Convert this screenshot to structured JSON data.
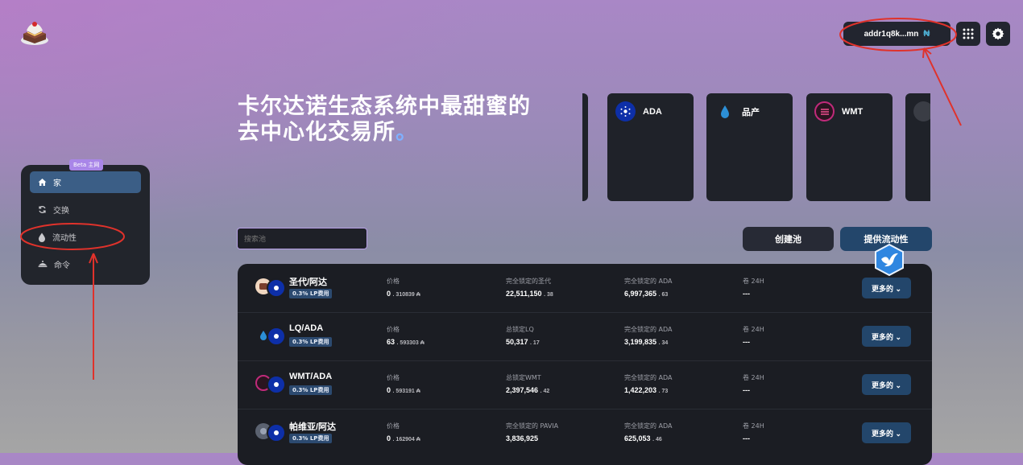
{
  "header": {
    "wallet_address": "addr1q8k...mn",
    "wallet_network_glyph": "₦"
  },
  "hero": {
    "line1": "卡尔达诺生态系统中最甜蜜的",
    "line2": "去中心化交易所",
    "dot": "。"
  },
  "tokens": [
    {
      "symbol": "ADA",
      "icon": "cardano-icon",
      "color": "#0d2fa8"
    },
    {
      "symbol": "品产",
      "icon": "water-drop-icon",
      "color": "#2c8fd6"
    },
    {
      "symbol": "WMT",
      "icon": "wmt-icon",
      "color": "#c02a7a"
    }
  ],
  "sidebar": {
    "badge": "Beta 主网",
    "items": [
      {
        "label": "家",
        "icon": "home-icon",
        "active": true
      },
      {
        "label": "交换",
        "icon": "swap-icon",
        "active": false
      },
      {
        "label": "流动性",
        "icon": "drop-icon",
        "active": false
      },
      {
        "label": "命令",
        "icon": "orders-icon",
        "active": false
      }
    ]
  },
  "search": {
    "placeholder": "搜索池"
  },
  "actions": {
    "create_pool": "创建池",
    "provide_liquidity": "提供流动性"
  },
  "pools": [
    {
      "pair": "圣代/阿达",
      "fee": "0.3% LP费用",
      "price_label": "价格",
      "price_main": "0",
      "price_small": ". 310839 ₳",
      "locked1_label": "完全锁定的圣代",
      "locked1_main": "22,511,150",
      "locked1_small": ". 38",
      "locked2_label": "完全锁定的 ADA",
      "locked2_main": "6,997,365",
      "locked2_small": ". 63",
      "vol_label": "卷 24H",
      "vol_value": "---",
      "more": "更多的 ⌄"
    },
    {
      "pair": "LQ/ADA",
      "fee": "0.3% LP费用",
      "price_label": "价格",
      "price_main": "63",
      "price_small": ". 593303 ₳",
      "locked1_label": "总锁定LQ",
      "locked1_main": "50,317",
      "locked1_small": ". 17",
      "locked2_label": "完全锁定的 ADA",
      "locked2_main": "3,199,835",
      "locked2_small": ". 34",
      "vol_label": "卷 24H",
      "vol_value": "---",
      "more": "更多的 ⌄"
    },
    {
      "pair": "WMT/ADA",
      "fee": "0.3% LP费用",
      "price_label": "价格",
      "price_main": "0",
      "price_small": ". 593191 ₳",
      "locked1_label": "总锁定WMT",
      "locked1_main": "2,397,546",
      "locked1_small": ". 42",
      "locked2_label": "完全锁定的 ADA",
      "locked2_main": "1,422,203",
      "locked2_small": ". 73",
      "vol_label": "卷 24H",
      "vol_value": "---",
      "more": "更多的 ⌄"
    },
    {
      "pair": "帕维亚/阿达",
      "fee": "0.3% LP费用",
      "price_label": "价格",
      "price_main": "0",
      "price_small": ". 162904 ₳",
      "locked1_label": "完全锁定的 PAVIA",
      "locked1_main": "3,836,925",
      "locked1_small": "",
      "locked2_label": "完全锁定的 ADA",
      "locked2_main": "625,053",
      "locked2_small": ". 46",
      "vol_label": "卷 24H",
      "vol_value": "---",
      "more": "更多的 ⌄"
    }
  ],
  "colors": {
    "accent_blue": "#23466b",
    "annotation_red": "#e0322b",
    "search_border": "#b7a0e6"
  }
}
